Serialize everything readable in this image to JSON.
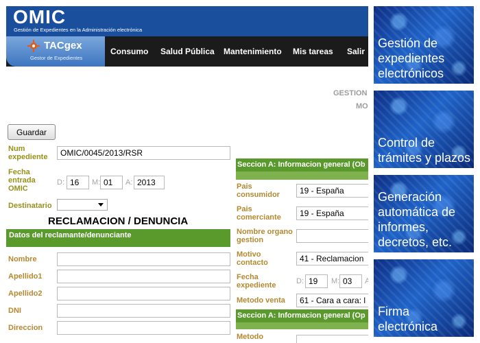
{
  "header": {
    "title": "OMIC",
    "subtitle": "Gestión de Expedientes en la Administración electrónica"
  },
  "brand": {
    "name": "TACgex",
    "tagline": "Gestor de Expedientes"
  },
  "nav": [
    "Consumo",
    "Salud Pública",
    "Mantenimiento",
    "Mis tareas",
    "Salir"
  ],
  "page_labels": {
    "gestion": "GESTION",
    "mo": "MO"
  },
  "toolbar": {
    "save_label": "Guardar"
  },
  "form": {
    "num_expediente_label": "Num expediente",
    "num_expediente_value": "OMIC/0045/2013/RSR",
    "fecha_label": "Fecha entrada OMIC",
    "day_prefix": "D:",
    "day": "16",
    "month_prefix": "M:",
    "month": "01",
    "year_prefix": "A:",
    "year": "2013",
    "destinatario_label": "Destinatario",
    "title": "RECLAMACION / DENUNCIA",
    "section_reclamante": "Datos del reclamante/denunciante",
    "fields": [
      "Nombre",
      "Apellido1",
      "Apellido2",
      "DNI",
      "Direccion"
    ]
  },
  "section_a": {
    "title": "Seccion A: Informacion general (Ob",
    "title2": "Seccion A: Informacion general (Op",
    "pais_consumidor_label": "Pais consumidor",
    "pais_consumidor": "19 - España",
    "pais_comerciante_label": "Pais comerciante",
    "pais_comerciante": "19 - España",
    "organo_label": "Nombre organo gestion",
    "motivo_label": "Motivo contacto",
    "motivo": "41 - Reclamacion",
    "fecha_exp_label": "Fecha expediente",
    "day_prefix": "D:",
    "day": "19",
    "month_prefix": "M:",
    "month": "03",
    "year_prefix": "A",
    "metodo_venta_label": "Metodo venta",
    "metodo_venta": "61 - Cara a cara: l",
    "metodo_label": "Metodo"
  },
  "sidebar": [
    "Gestión de expedientes electrónicos",
    "Control de trámites y plazos",
    "Generación automática de informes, decretos, etc.",
    "Firma electrónica"
  ],
  "colors": {
    "header_blue": "#1a4f9e",
    "navbar_black": "#1b1b1b",
    "green": "#5a9a2c",
    "label_olive": "#96911a",
    "label_orange": "#b5882f"
  }
}
